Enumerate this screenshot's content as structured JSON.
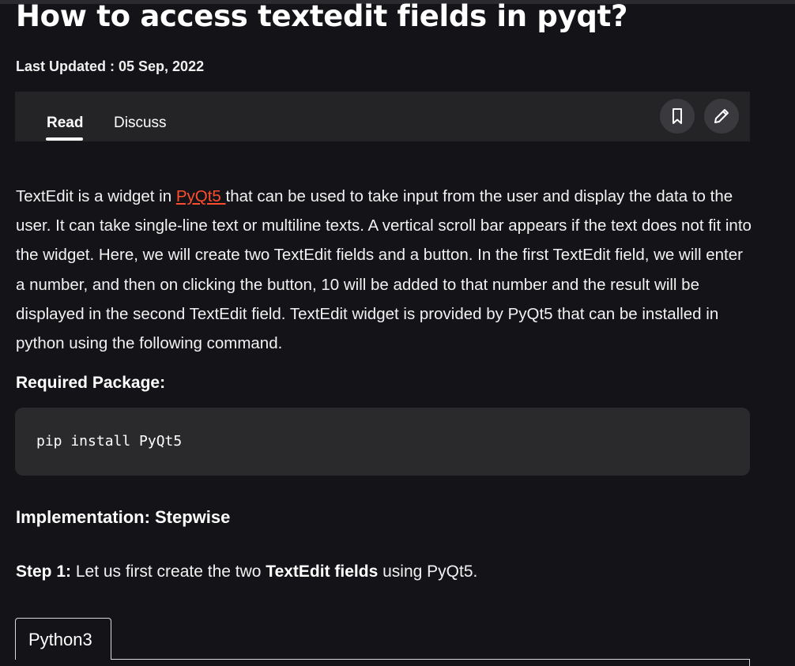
{
  "article": {
    "title": "How to access textedit fields in pyqt?",
    "last_updated": "Last Updated : 05 Sep, 2022"
  },
  "tabs": {
    "read": "Read",
    "discuss": "Discuss"
  },
  "actions": {
    "bookmark_icon": "bookmark-icon",
    "edit_icon": "pencil-icon"
  },
  "content": {
    "intro_before_link": "TextEdit is a widget in ",
    "link_text": "PyQt5 ",
    "intro_after_link": "that can be used to take input from the user and display the data to the user. It can take single-line text or multiline texts. A vertical scroll bar appears if the text does not fit into the widget. Here, we will create two TextEdit fields and a button. In the first TextEdit field, we will enter a number, and then on clicking the button, 10 will be added to that number and the result will be displayed in the second TextEdit field. TextEdit widget is provided by PyQt5 that can be installed in python using the following command.",
    "required_heading": "Required Package:",
    "install_command": "pip install PyQt5",
    "impl_heading": "Implementation: Stepwise",
    "step_label": "Step 1:",
    "step_text_1": " Let us first create the two ",
    "step_bold": "TextEdit fields",
    "step_text_2": " using PyQt5."
  },
  "code_tabs": {
    "python3": "Python3"
  },
  "colors": {
    "background": "#141317",
    "panel": "#242427",
    "link": "#ff4d2e"
  }
}
